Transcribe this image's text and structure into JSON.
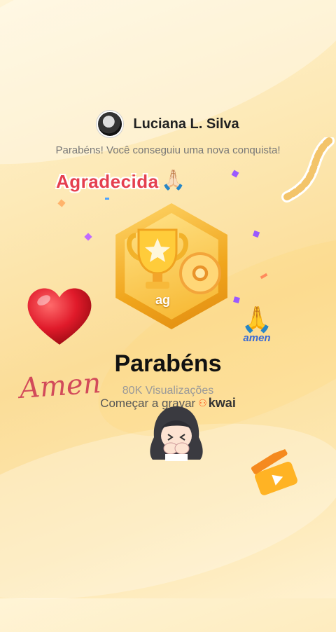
{
  "user": {
    "name": "Luciana L. Silva"
  },
  "subtitle": "Parabéns! Você conseguiu uma nova conquista!",
  "stickers": {
    "agradecida": "Agradecida",
    "amen_small": "amen",
    "amen_script": "Amen"
  },
  "badge": {
    "label": "ag"
  },
  "title": "Parabéns",
  "views": "80K Visualizações",
  "start_recording": "Começar a gravar",
  "brand": {
    "name": "kwai",
    "mark": "⚇"
  },
  "colors": {
    "accent_red": "#e53f4f",
    "badge_gold": "#f0a51c",
    "kwai_orange": "#ff5a1f",
    "amen_blue": "#3a6ad4"
  },
  "icons": {
    "pray_small": "🙏🏻",
    "pray_large": "🙏"
  }
}
